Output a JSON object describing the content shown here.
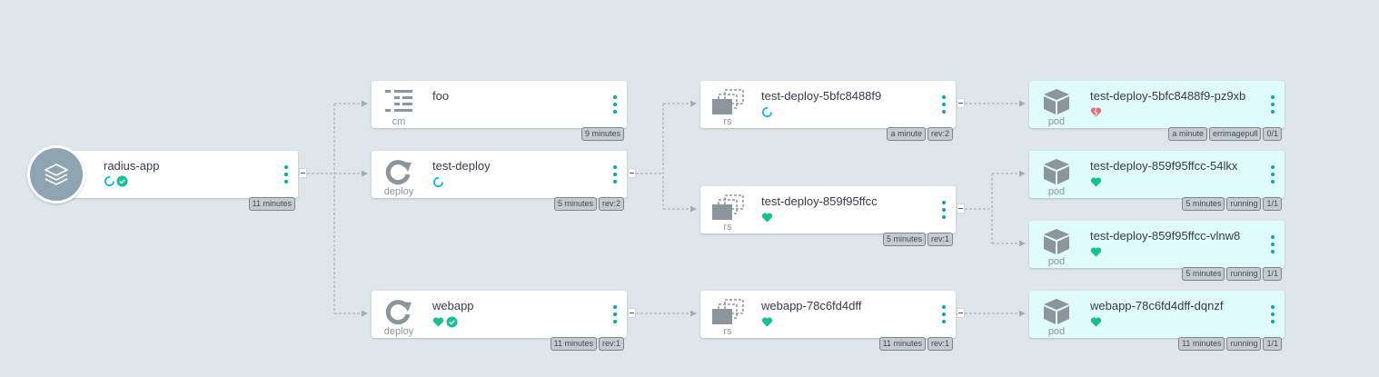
{
  "app": {
    "name": "radius-app",
    "age": "11 minutes"
  },
  "nodes": {
    "foo": {
      "kind": "cm",
      "name": "foo",
      "age": "9 minutes"
    },
    "deploy_test": {
      "kind": "deploy",
      "name": "test-deploy",
      "age": "5 minutes",
      "rev": "rev:2"
    },
    "deploy_webapp": {
      "kind": "deploy",
      "name": "webapp",
      "age": "11 minutes",
      "rev": "rev:1"
    },
    "rs_5bfc": {
      "kind": "rs",
      "name": "test-deploy-5bfc8488f9",
      "age": "a minute",
      "rev": "rev:2"
    },
    "rs_859f": {
      "kind": "rs",
      "name": "test-deploy-859f95ffcc",
      "age": "5 minutes",
      "rev": "rev:1"
    },
    "rs_webapp": {
      "kind": "rs",
      "name": "webapp-78c6fd4dff",
      "age": "11 minutes",
      "rev": "rev:1"
    },
    "pod_pz9xb": {
      "kind": "pod",
      "name": "test-deploy-5bfc8488f9-pz9xb",
      "age": "a minute",
      "state": "errimagepull",
      "ready": "0/1"
    },
    "pod_54lkx": {
      "kind": "pod",
      "name": "test-deploy-859f95ffcc-54lkx",
      "age": "5 minutes",
      "state": "running",
      "ready": "1/1"
    },
    "pod_vlnw8": {
      "kind": "pod",
      "name": "test-deploy-859f95ffcc-vlnw8",
      "age": "5 minutes",
      "state": "running",
      "ready": "1/1"
    },
    "pod_dqnzf": {
      "kind": "pod",
      "name": "webapp-78c6fd4dff-dqnzf",
      "age": "11 minutes",
      "state": "running",
      "ready": "1/1"
    }
  },
  "colors": {
    "background": "#dee6eb",
    "menu_dots": "#08a7b4",
    "healthy": "#18be94",
    "progressing": "#0dadea",
    "degraded": "#e96d76",
    "pod_background": "#dffbfb",
    "edge": "#a3aab0"
  },
  "icons": {
    "app": "layers-icon",
    "cm": "list-icon",
    "deploy": "redo-icon",
    "rs": "clone-icon",
    "pod": "cube-icon",
    "healthy": "heart-icon",
    "progressing": "spinner-icon",
    "synced": "check-circle-icon",
    "degraded": "broken-heart-icon"
  }
}
